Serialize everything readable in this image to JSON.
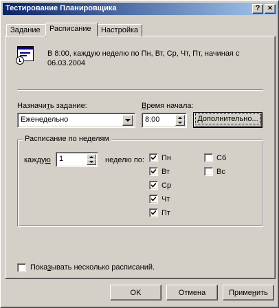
{
  "window": {
    "title": "Тестирование Планировщика",
    "help_glyph": "?",
    "close_glyph": "×"
  },
  "tabs": [
    {
      "label": "Задание",
      "active": false
    },
    {
      "label": "Расписание",
      "active": true
    },
    {
      "label": "Настройка",
      "active": false
    }
  ],
  "summary": {
    "icon": "schedule-clock-icon",
    "text": "В 8:00, каждую неделю по Пн, Вт, Ср, Чт, Пт, начиная с 06.03.2004"
  },
  "schedule_task": {
    "label_pre": "Назначи",
    "label_accel": "т",
    "label_post": "ь задание:",
    "value": "Еженедельно"
  },
  "start_time": {
    "label_accel": "В",
    "label_post": "ремя начала:",
    "value": "8:00"
  },
  "advanced_button": {
    "label_pre": "",
    "label_accel": "Д",
    "label_post": "ополнительно..."
  },
  "weekly": {
    "title": "Расписание по неделям",
    "every_pre": "кажду",
    "every_accel": "ю",
    "every_value": "1",
    "week_on": "неделю по:",
    "days": [
      {
        "label": "Пн",
        "checked": true
      },
      {
        "label": "Вт",
        "checked": true
      },
      {
        "label": "Ср",
        "checked": true
      },
      {
        "label": "Чт",
        "checked": true
      },
      {
        "label": "Пт",
        "checked": true
      },
      {
        "label": "Сб",
        "checked": false
      },
      {
        "label": "Вс",
        "checked": false
      }
    ]
  },
  "multiple_schedules": {
    "label_pre": "Пока",
    "label_accel": "з",
    "label_post": "ывать несколько расписаний.",
    "checked": false
  },
  "footer": {
    "ok": "OK",
    "cancel": "Отмена",
    "apply_pre": "Приме",
    "apply_accel": "н",
    "apply_post": "ить"
  }
}
